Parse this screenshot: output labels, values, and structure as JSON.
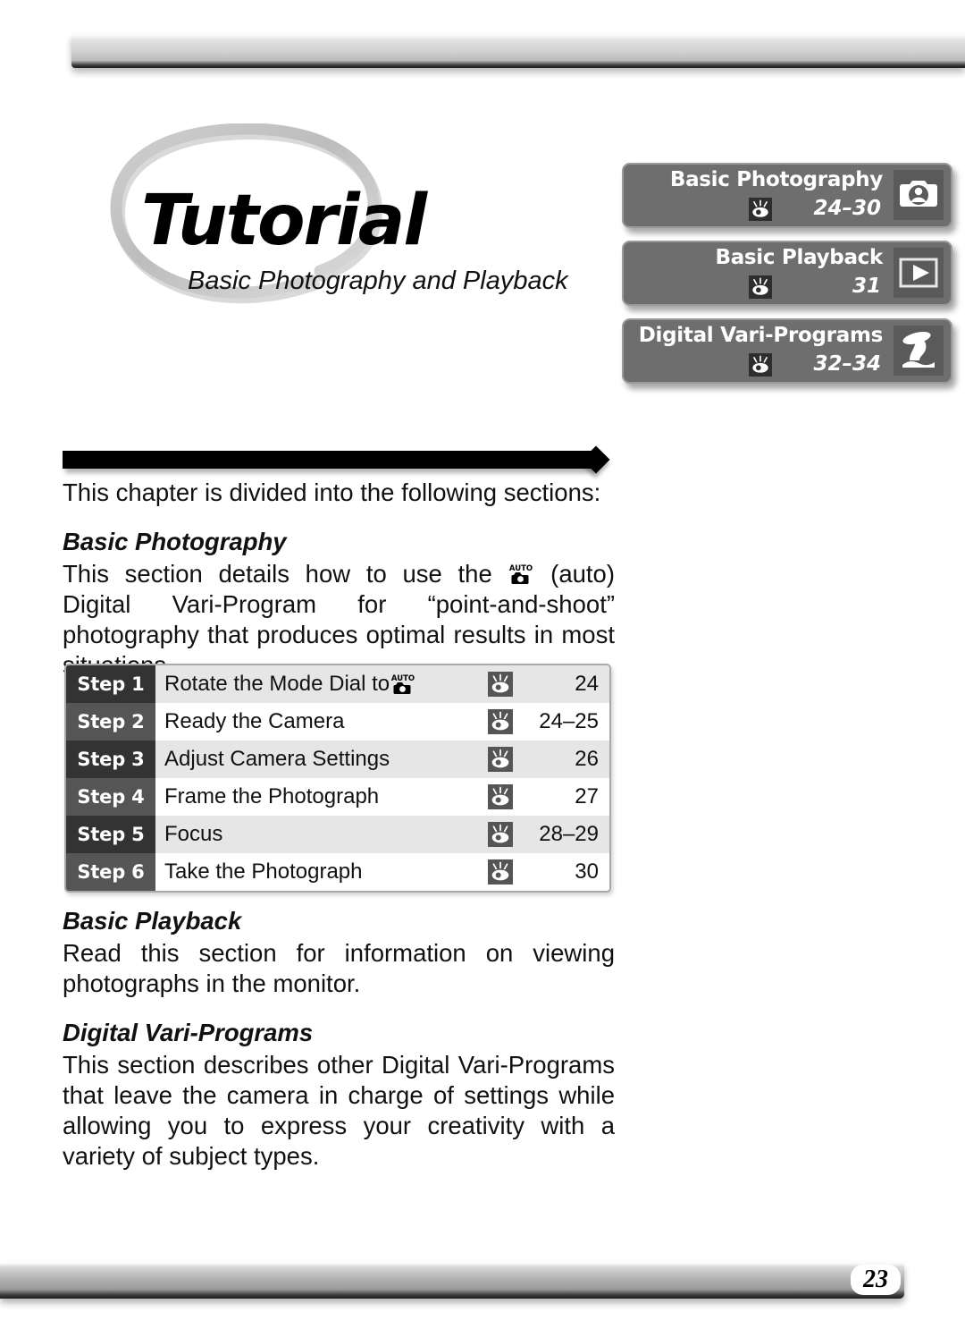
{
  "page": {
    "number": "23"
  },
  "title": {
    "main": "Tutorial",
    "subtitle": "Basic Photography and Playback"
  },
  "nav_boxes": [
    {
      "title": "Basic Photography",
      "pages": "24–30",
      "eye_icon": "eye-reference-icon",
      "mode_icon": "camera-portrait-icon"
    },
    {
      "title": "Basic Playback",
      "pages": "31",
      "eye_icon": "eye-reference-icon",
      "mode_icon": "playback-play-icon"
    },
    {
      "title": "Digital Vari-Programs",
      "pages": "32–34",
      "eye_icon": "eye-reference-icon",
      "mode_icon": "vari-program-portrait-icon"
    }
  ],
  "intro": "This chapter is divided into the following sections:",
  "sections": [
    {
      "heading": "Basic Photography",
      "body_before_icon": "This section details how to use the ",
      "icon": "auto-mode-icon",
      "body_after_icon": " (auto) Digital Vari-Program for “point-and-shoot” photography that produces optimal results in most situations."
    },
    {
      "heading": "Basic Playback",
      "body": "Read this section for information on viewing photographs in the monitor."
    },
    {
      "heading": "Digital Vari-Programs",
      "body": "This section describes other Digital Vari-Programs that leave the camera in charge of settings while allowing you to express your creativity with a variety of subject types."
    }
  ],
  "steps_table": {
    "rows": [
      {
        "tag": "Step 1",
        "label_prefix": "Rotate the Mode Dial to ",
        "has_auto_icon": true,
        "eye_icon": "eye-reference-icon",
        "page": "24"
      },
      {
        "tag": "Step 2",
        "label_prefix": "Ready the Camera",
        "has_auto_icon": false,
        "eye_icon": "eye-reference-icon",
        "page": "24–25"
      },
      {
        "tag": "Step 3",
        "label_prefix": "Adjust Camera Settings",
        "has_auto_icon": false,
        "eye_icon": "eye-reference-icon",
        "page": "26"
      },
      {
        "tag": "Step 4",
        "label_prefix": "Frame the Photograph",
        "has_auto_icon": false,
        "eye_icon": "eye-reference-icon",
        "page": "27"
      },
      {
        "tag": "Step 5",
        "label_prefix": "Focus",
        "has_auto_icon": false,
        "eye_icon": "eye-reference-icon",
        "page": "28–29"
      },
      {
        "tag": "Step 6",
        "label_prefix": "Take the Photograph",
        "has_auto_icon": false,
        "eye_icon": "eye-reference-icon",
        "page": "30"
      }
    ]
  },
  "colors": {
    "nav_box_bg": "#6e6e6e",
    "nav_box_border": "#9a9a9a",
    "step_tag_odd": "#333333",
    "step_tag_even": "#555555",
    "row_odd_bg": "#e6e6e6",
    "row_even_bg": "#ffffff",
    "rule_bar": "#000000"
  }
}
